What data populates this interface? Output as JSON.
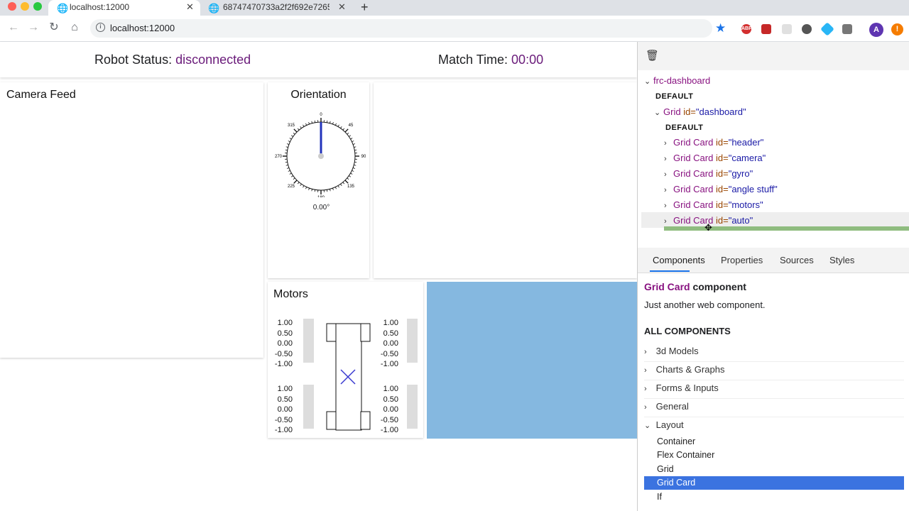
{
  "browser": {
    "tabs": [
      {
        "title": "localhost:12000",
        "active": true
      },
      {
        "title": "68747470733a2f2f692e72656",
        "active": false
      }
    ],
    "url": "localhost:12000",
    "extensions": [
      "ABP",
      "",
      "",
      "",
      "",
      "",
      "A",
      "!"
    ]
  },
  "dashboard": {
    "header": {
      "robot_status_label": "Robot Status:",
      "robot_status_value": "disconnected",
      "match_time_label": "Match Time:",
      "match_time_value": "00:00"
    },
    "camera": {
      "title": "Camera Feed"
    },
    "orientation": {
      "title": "Orientation",
      "dial_labels": [
        "0",
        "45",
        "90",
        "135",
        "180",
        "225",
        "270",
        "315"
      ],
      "value": "0.00°"
    },
    "motors": {
      "title": "Motors",
      "scale": [
        "1.00",
        "0.50",
        "0.00",
        "-0.50",
        "-1.00"
      ]
    }
  },
  "devtools": {
    "tree": {
      "root": "frc-dashboard",
      "slot1": "DEFAULT",
      "grid_tag": "Grid",
      "grid_attr": "id=",
      "grid_val": "\"dashboard\"",
      "slot2": "DEFAULT",
      "cards": [
        {
          "tag": "Grid Card",
          "attr": "id=",
          "val": "\"header\""
        },
        {
          "tag": "Grid Card",
          "attr": "id=",
          "val": "\"camera\""
        },
        {
          "tag": "Grid Card",
          "attr": "id=",
          "val": "\"gyro\""
        },
        {
          "tag": "Grid Card",
          "attr": "id=",
          "val": "\"angle stuff\""
        },
        {
          "tag": "Grid Card",
          "attr": "id=",
          "val": "\"motors\""
        },
        {
          "tag": "Grid Card",
          "attr": "id=",
          "val": "\"auto\""
        }
      ]
    },
    "tabs": [
      "Components",
      "Properties",
      "Sources",
      "Styles"
    ],
    "component_name": "Grid Card",
    "component_suffix": "component",
    "component_desc": "Just another web component.",
    "all_components_heading": "ALL COMPONENTS",
    "categories": [
      "3d Models",
      "Charts & Graphs",
      "Forms & Inputs",
      "General",
      "Layout"
    ],
    "layout_items": [
      "Container",
      "Flex Container",
      "Grid",
      "Grid Card",
      "If"
    ],
    "selected_item": "Grid Card",
    "colors": {
      "tag": "#881280",
      "attr": "#994500",
      "val": "#1a1aa6",
      "selected": "#3b73e0",
      "drop_line": "#8fbc7f",
      "blue_panel": "#85b8e0"
    }
  }
}
